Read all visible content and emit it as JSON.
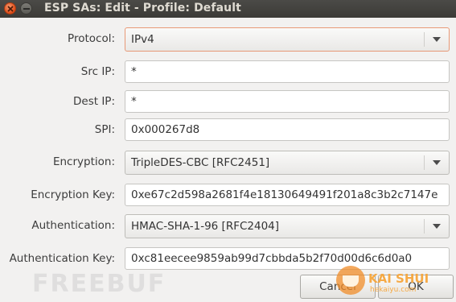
{
  "window": {
    "title": "ESP SAs: Edit - Profile: Default",
    "close_icon": "close-icon",
    "minimize_icon": "minimize-icon"
  },
  "form": {
    "protocol": {
      "label": "Protocol:",
      "value": "IPv4"
    },
    "src_ip": {
      "label": "Src IP:",
      "value": "*"
    },
    "dest_ip": {
      "label": "Dest IP:",
      "value": "*"
    },
    "spi": {
      "label": "SPI:",
      "value": "0x000267d8"
    },
    "encryption": {
      "label": "Encryption:",
      "value": "TripleDES-CBC [RFC2451]"
    },
    "encryption_key": {
      "label": "Encryption Key:",
      "value": "0xe67c2d598a2681f4e18130649491f201a8c3b2c7147e"
    },
    "authentication": {
      "label": "Authentication:",
      "value": "HMAC-SHA-1-96 [RFC2404]"
    },
    "auth_key": {
      "label": "Authentication Key:",
      "value": "0xc81eecee9859ab99d7cbbda5b2f70d00d6c6d0a0"
    }
  },
  "buttons": {
    "cancel_label": "Cancel",
    "ok_label": "OK"
  },
  "watermarks": {
    "left": "FREEBUF",
    "right_title": "KAI SHUI",
    "right_url": "hekaiyu.com"
  }
}
